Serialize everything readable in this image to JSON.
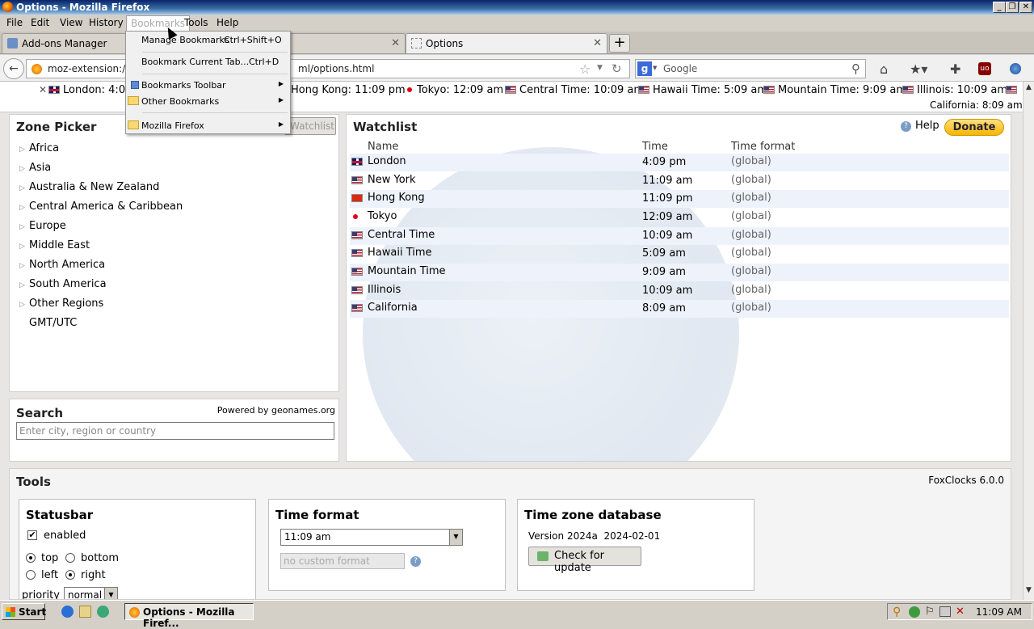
{
  "window": {
    "title": "Options - Mozilla Firefox"
  },
  "menubar": {
    "items": [
      "File",
      "Edit",
      "View",
      "History",
      "Bookmarks",
      "Tools",
      "Help"
    ]
  },
  "tabs": [
    {
      "label": "Add-ons Manager",
      "selected": false
    },
    {
      "label": "Options",
      "selected": true
    }
  ],
  "navbar": {
    "url_start": "moz-extension://41",
    "url_end": "ml/options.html",
    "search_engine": "Google",
    "search_placeholder": "Google"
  },
  "bookmarks_menu": {
    "items": [
      {
        "label": "Manage Bookmarks",
        "shortcut": "Ctrl+Shift+O"
      },
      {
        "label": "Bookmark Current Tab...",
        "shortcut": "Ctrl+D"
      },
      {
        "label": "Bookmarks Toolbar",
        "submenu": true
      },
      {
        "label": "Other Bookmarks",
        "submenu": true
      },
      {
        "label": "Mozilla Firefox",
        "submenu": true
      }
    ]
  },
  "clockbar": {
    "clocks": [
      {
        "label": "London: 4:09"
      },
      {
        "label": "Hong Kong: 11:09 pm"
      },
      {
        "label": "Tokyo: 12:09 am"
      },
      {
        "label": "Central Time: 10:09 am"
      },
      {
        "label": "Hawaii Time: 5:09 am"
      },
      {
        "label": "Mountain Time: 9:09 am"
      },
      {
        "label": "Illinois: 10:09 am"
      },
      {
        "label": "California: 8:09 am"
      }
    ]
  },
  "zone_picker": {
    "title": "Zone Picker",
    "add_button": "Watchlist",
    "regions": [
      "Africa",
      "Asia",
      "Australia & New Zealand",
      "Central America & Caribbean",
      "Europe",
      "Middle East",
      "North America",
      "South America",
      "Other Regions",
      "GMT/UTC"
    ]
  },
  "search": {
    "title": "Search",
    "powered_by": "Powered by geonames.org",
    "placeholder": "Enter city, region or country"
  },
  "watchlist": {
    "title": "Watchlist",
    "help": "Help",
    "donate": "Donate",
    "columns": [
      "Name",
      "Time",
      "Time format"
    ],
    "rows": [
      {
        "name": "London",
        "time": "4:09 pm",
        "format": "(global)",
        "flag": "gb"
      },
      {
        "name": "New York",
        "time": "11:09 am",
        "format": "(global)",
        "flag": "us"
      },
      {
        "name": "Hong Kong",
        "time": "11:09 pm",
        "format": "(global)",
        "flag": "hk"
      },
      {
        "name": "Tokyo",
        "time": "12:09 am",
        "format": "(global)",
        "flag": "jp"
      },
      {
        "name": "Central Time",
        "time": "10:09 am",
        "format": "(global)",
        "flag": "us"
      },
      {
        "name": "Hawaii Time",
        "time": "5:09 am",
        "format": "(global)",
        "flag": "us"
      },
      {
        "name": "Mountain Time",
        "time": "9:09 am",
        "format": "(global)",
        "flag": "us"
      },
      {
        "name": "Illinois",
        "time": "10:09 am",
        "format": "(global)",
        "flag": "us"
      },
      {
        "name": "California",
        "time": "8:09 am",
        "format": "(global)",
        "flag": "us"
      }
    ]
  },
  "tools": {
    "title": "Tools",
    "version": "FoxClocks 6.0.0",
    "statusbar": {
      "title": "Statusbar",
      "enabled_label": "enabled",
      "enabled": true,
      "top": "top",
      "bottom": "bottom",
      "left": "left",
      "right": "right",
      "vertical": "top",
      "horizontal": "right",
      "priority_label": "priority",
      "priority_value": "normal"
    },
    "time_format": {
      "title": "Time format",
      "selected": "11:09 am",
      "custom_placeholder": "no custom format"
    },
    "tz_database": {
      "title": "Time zone database",
      "version": "Version 2024a  2024-02-01",
      "check_button": "Check for update"
    }
  },
  "taskbar": {
    "start": "Start",
    "task": "Options - Mozilla Firef...",
    "time": "11:09 AM"
  }
}
